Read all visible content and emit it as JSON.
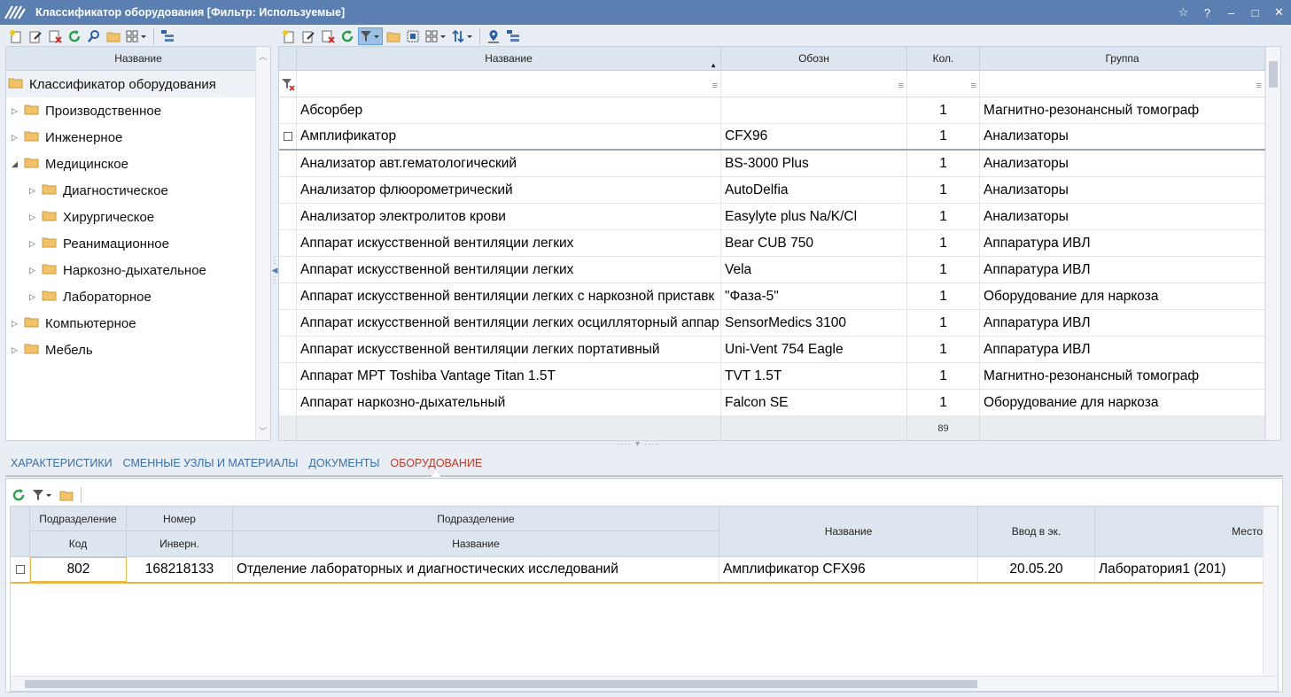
{
  "window": {
    "title": "Классификатор оборудования [Фильтр: Используемые]",
    "controls": [
      "☆",
      "?",
      "–",
      "□",
      "✕"
    ]
  },
  "tree": {
    "header": "Название",
    "root": "Классификатор оборудования",
    "items": [
      {
        "label": "Производственное",
        "level": 1,
        "expanded": false
      },
      {
        "label": "Инженерное",
        "level": 1,
        "expanded": false
      },
      {
        "label": "Медицинское",
        "level": 1,
        "expanded": true
      },
      {
        "label": "Диагностическое",
        "level": 2,
        "expanded": false
      },
      {
        "label": "Хирургическое",
        "level": 2,
        "expanded": false
      },
      {
        "label": "Реанимационное",
        "level": 2,
        "expanded": false
      },
      {
        "label": "Наркозно-дыхательное",
        "level": 2,
        "expanded": false
      },
      {
        "label": "Лабораторное",
        "level": 2,
        "expanded": false
      },
      {
        "label": "Компьютерное",
        "level": 1,
        "expanded": false
      },
      {
        "label": "Мебель",
        "level": 1,
        "expanded": false
      }
    ]
  },
  "grid": {
    "columns": {
      "name": "Название",
      "code": "Обозн",
      "qty": "Кол.",
      "group": "Группа"
    },
    "sort_indicator": "▲",
    "filter_glyph": "≡",
    "rows": [
      {
        "name": "Абсорбер",
        "code": "",
        "qty": "1",
        "group": "Магнитно-резонансный томограф"
      },
      {
        "name": "Амплификатор",
        "code": "CFX96",
        "qty": "1",
        "group": "Анализаторы"
      },
      {
        "name": "Анализатор авт.гематологический",
        "code": "BS-3000 Plus",
        "qty": "1",
        "group": "Анализаторы"
      },
      {
        "name": "Анализатор флюорометрический",
        "code": "AutoDelfia",
        "qty": "1",
        "group": "Анализаторы"
      },
      {
        "name": "Анализатор электролитов крови",
        "code": "Easylyte plus Na/K/Cl",
        "qty": "1",
        "group": "Анализаторы"
      },
      {
        "name": "Аппарат искусственной вентиляции легких",
        "code": "Bear CUB 750",
        "qty": "1",
        "group": "Аппаратура ИВЛ"
      },
      {
        "name": "Аппарат искусственной вентиляции легких",
        "code": "Vela",
        "qty": "1",
        "group": "Аппаратура ИВЛ"
      },
      {
        "name": "Аппарат искусственной вентиляции легких  с наркозной приставк",
        "code": "\"Фаза-5\"",
        "qty": "1",
        "group": "Оборудование для наркоза"
      },
      {
        "name": "Аппарат искусственной вентиляции легких осцилляторный аппар",
        "code": "SensorMedics 3100",
        "qty": "1",
        "group": "Аппаратура ИВЛ"
      },
      {
        "name": "Аппарат искусственной вентиляции легких портативный",
        "code": "Uni-Vent 754 Eagle",
        "qty": "1",
        "group": "Аппаратура ИВЛ"
      },
      {
        "name": "Аппарат МРТ Toshiba Vantage Titan 1.5T",
        "code": "TVT 1.5T",
        "qty": "1",
        "group": "Магнитно-резонансный томограф"
      },
      {
        "name": "Аппарат наркозно-дыхательный",
        "code": "Falcon SE",
        "qty": "1",
        "group": "Оборудование для наркоза"
      }
    ],
    "footer_total": "89"
  },
  "tabs": [
    {
      "label": "ХАРАКТЕРИСТИКИ",
      "active": false
    },
    {
      "label": "СМЕННЫЕ УЗЛЫ И МАТЕРИАЛЫ",
      "active": false
    },
    {
      "label": "ДОКУМЕНТЫ",
      "active": false
    },
    {
      "label": "ОБОРУДОВАНИЕ",
      "active": true
    }
  ],
  "bottom_grid": {
    "headers": {
      "dept_top": "Подразделение",
      "dept_code": "Код",
      "number_top": "Номер",
      "number_inv": "Инверн.",
      "dept2_top": "Подразделение",
      "dept2_name": "Название",
      "name": "Название",
      "commission": "Ввод в эк.",
      "place": "Место"
    },
    "rows": [
      {
        "code": "802",
        "inv": "168218133",
        "dept": "Отделение лабораторных и диагностических исследований",
        "name": "Амплификатор CFX96",
        "date": "20.05.20",
        "place": "Лаборатория1 (201)"
      }
    ]
  },
  "colors": {
    "titlebar": "#5b7fb0",
    "header_bg": "#dde6ef",
    "active_tab": "#c0392b",
    "tab_text": "#3a6ea5",
    "row_highlight": "#e8b84a"
  }
}
